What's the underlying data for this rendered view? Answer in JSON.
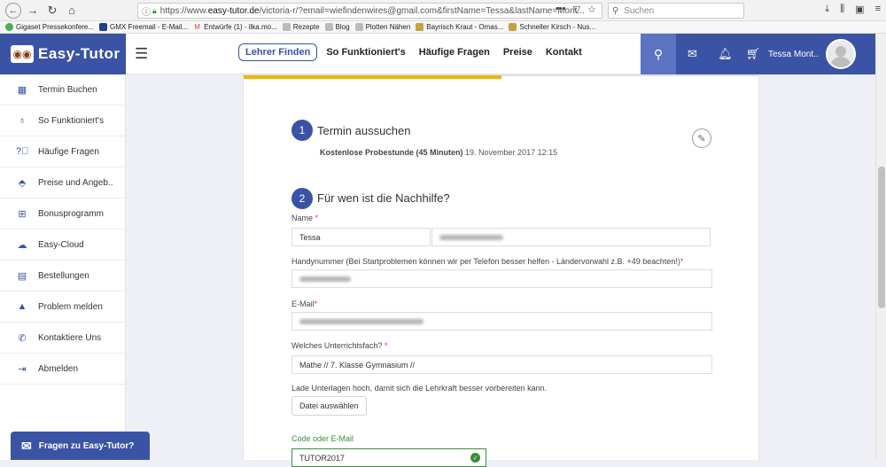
{
  "browser": {
    "url_prefix": "https://www.",
    "url_host": "easy-tutor.de",
    "url_rest": "/victoria-r/?email=wiefindenwires@gmail.com&firstName=Tessa&lastName=Mont...",
    "search_placeholder": "Suchen",
    "bookmarks": [
      "Gigaset Pressekonfere...",
      "GMX Freemail - E-Mail...",
      "Entwürfe (1) - ilka.mo...",
      "Rezepte",
      "Blog",
      "Plotten Nähen",
      "Bayrisch Kraut - Omas...",
      "Schneller Kirsch - Nus..."
    ]
  },
  "header": {
    "logo": "Easy-Tutor",
    "find_tutor": "Lehrer Finden",
    "nav": [
      "So Funktioniert's",
      "Häufige Fragen",
      "Preise",
      "Kontakt"
    ],
    "user_name": "Tessa Mont.."
  },
  "sidebar": {
    "items": [
      {
        "label": "Termin Buchen",
        "icon": "calendar-icon"
      },
      {
        "label": "So Funktioniert's",
        "icon": "lightbulb-icon"
      },
      {
        "label": "Häufige Fragen",
        "icon": "question-icon"
      },
      {
        "label": "Preise und Angeb..",
        "icon": "tag-icon"
      },
      {
        "label": "Bonusprogramm",
        "icon": "gift-icon"
      },
      {
        "label": "Easy-Cloud",
        "icon": "cloud-icon"
      },
      {
        "label": "Bestellungen",
        "icon": "receipt-icon"
      },
      {
        "label": "Problem melden",
        "icon": "warning-icon"
      },
      {
        "label": "Kontaktiere Uns",
        "icon": "whatsapp-icon"
      },
      {
        "label": "Abmelden",
        "icon": "logout-icon"
      }
    ],
    "help_button": "Fragen zu Easy-Tutor?"
  },
  "form": {
    "step1_num": "1",
    "step1_title": "Termin aussuchen",
    "step1_bold": "Kostenlose Probestunde (45 Minuten)",
    "step1_date": " 19. November 2017 12:15",
    "step2_num": "2",
    "step2_title": "Für wen ist die Nachhilfe?",
    "name_label": "Name",
    "first_name_value": "Tessa",
    "phone_label": "Handynummer (Bei Startproblemen können wir per Telefon besser helfen - Ländervorwahl z.B. +49 beachten!)",
    "email_label": "E-Mail",
    "subject_label": "Welches Unterrichtsfach?",
    "subject_value": "Mathe // 7. Klasse Gymnasium //",
    "upload_label": "Lade Unterlagen hoch, damit sich die Lehrkraft besser vorbereiten kann.",
    "file_button": "Datei auswählen",
    "code_label": "Code oder E-Mail",
    "code_value": "TUTOR2017",
    "required_mark": "*"
  },
  "colors": {
    "primary": "#3a53a4",
    "progress": "#f0b400",
    "success": "#3a8f3a"
  }
}
